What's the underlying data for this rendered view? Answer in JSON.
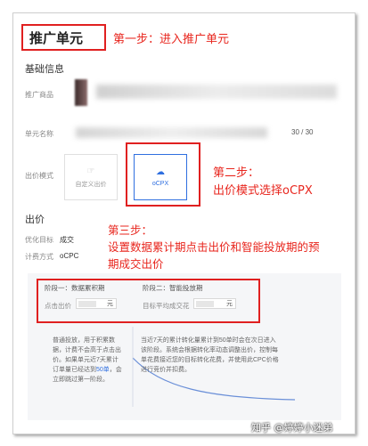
{
  "page": {
    "title": "推广单元"
  },
  "annotations": {
    "step1": "第一步：进入推广单元",
    "step2_line1": "第二步：",
    "step2_line2": "出价模式选择oCPX",
    "step3_line1": "第三步：",
    "step3_line2": "设置数据累计期点击出价和智能投放期的预",
    "step3_line3": "期成交出价"
  },
  "basic_info": {
    "section_title": "基础信息",
    "product_label": "推广商品",
    "unit_name_label": "单元名称",
    "name_counter": "30 / 30",
    "bid_mode_label": "出价模式",
    "bid_modes": [
      {
        "label": "自定义出价",
        "icon": "custom-bid-icon",
        "selected": false
      },
      {
        "label": "oCPX",
        "icon": "ocpx-icon",
        "selected": true
      }
    ]
  },
  "bid": {
    "section_title": "出价",
    "goal_label": "优化目标",
    "goal_value": "成交",
    "billing_label": "计费方式",
    "billing_value": "oCPC"
  },
  "phases": [
    {
      "title": "阶段一：数据累积期",
      "field_label": "点击出价",
      "unit": "元"
    },
    {
      "title": "阶段二：智能投放期",
      "field_label": "目标平均成交花",
      "unit": "元"
    }
  ],
  "phase_descriptions": {
    "left_1": "普通投放，用于积累数",
    "left_2": "据，计费不会高于点击出",
    "left_3": "价。如果单元近7天累计",
    "left_4_pre": "订单量已经达到",
    "left_4_link": "50单",
    "left_4_post": "，会",
    "left_5": "立即跳过第一阶段。",
    "right_1": "当近7天的累计转化量累计到50单时会在次日进入",
    "right_2": "该阶段。系统会根据转化率动态调整出价，控制每",
    "right_3": "单花费接近您的目标转化花费，并使用此CPC价格",
    "right_4": "进行竞价并扣费。"
  },
  "watermark": "知乎 @婷婷小迷弟",
  "colors": {
    "annotation_red": "#e8261e",
    "selected_blue": "#2f6fe0"
  }
}
